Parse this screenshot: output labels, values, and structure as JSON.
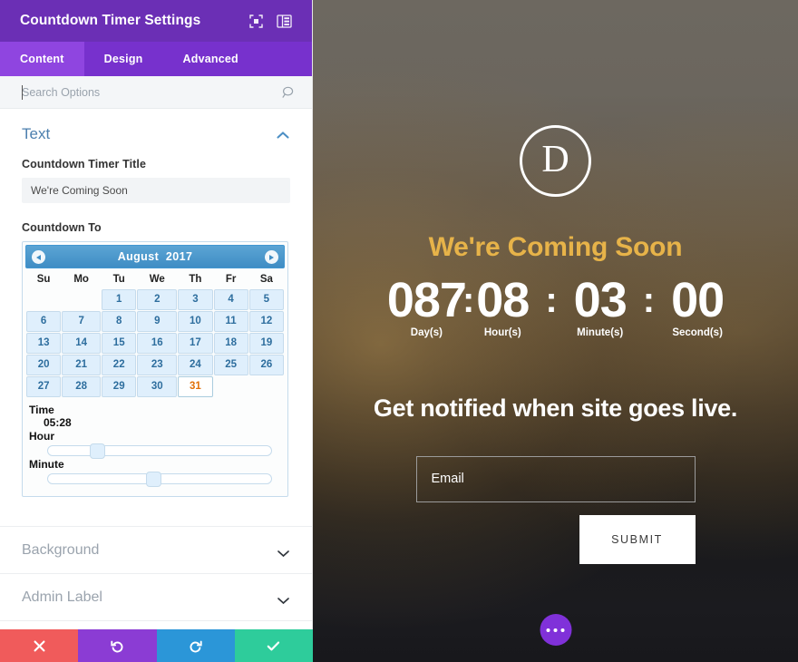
{
  "panel": {
    "title": "Countdown Timer Settings",
    "header_icons": [
      {
        "name": "fullscreen-icon",
        "glyph": "fullscreen"
      },
      {
        "name": "layout-columns-icon",
        "glyph": "layout"
      }
    ],
    "tabs": [
      {
        "label": "Content",
        "active": true
      },
      {
        "label": "Design",
        "active": false
      },
      {
        "label": "Advanced",
        "active": false
      }
    ],
    "search": {
      "placeholder": "Search Options",
      "value": "",
      "icon": "search-icon"
    },
    "section": {
      "title": "Text",
      "toggle_icon": "chevron-up-icon",
      "title_field": {
        "label": "Countdown Timer Title",
        "value": "We're Coming Soon"
      },
      "date_field": {
        "label": "Countdown To"
      }
    },
    "datepicker": {
      "prev_icon": "chevron-left-icon",
      "next_icon": "chevron-right-icon",
      "month": "August",
      "year": "2017",
      "weekdays": [
        "Su",
        "Mo",
        "Tu",
        "We",
        "Th",
        "Fr",
        "Sa"
      ],
      "leading_blanks": 2,
      "days": [
        1,
        2,
        3,
        4,
        5,
        6,
        7,
        8,
        9,
        10,
        11,
        12,
        13,
        14,
        15,
        16,
        17,
        18,
        19,
        20,
        21,
        22,
        23,
        24,
        25,
        26,
        27,
        28,
        29,
        30,
        31
      ],
      "selected_day": 31,
      "time_label": "Time",
      "time_value": "05:28",
      "hour_label": "Hour",
      "hour_percent": 22,
      "minute_label": "Minute",
      "minute_percent": 47
    },
    "accordions": [
      {
        "label": "Background",
        "icon": "chevron-down-icon"
      },
      {
        "label": "Admin Label",
        "icon": "chevron-down-icon"
      }
    ],
    "actions": [
      {
        "name": "close-button",
        "icon": "close-icon",
        "color": "#f05b5b"
      },
      {
        "name": "undo-button",
        "icon": "undo-icon",
        "color": "#8b3cd4"
      },
      {
        "name": "redo-button",
        "icon": "redo-icon",
        "color": "#2b96d8"
      },
      {
        "name": "save-button",
        "icon": "check-icon",
        "color": "#2ecc9b"
      }
    ]
  },
  "preview": {
    "logo_letter": "D",
    "headline": "We're Coming Soon",
    "headline_color": "#e7b349",
    "countdown": {
      "days": {
        "value": "087",
        "label": "Day(s)"
      },
      "hours": {
        "value": "08",
        "label": "Hour(s)"
      },
      "minutes": {
        "value": "03",
        "label": "Minute(s)"
      },
      "seconds": {
        "value": "00",
        "label": "Second(s)"
      },
      "separator": ":"
    },
    "subheadline": "Get notified when site goes live.",
    "email_placeholder": "Email",
    "email_value": "",
    "submit_label": "SUBMIT",
    "fab": {
      "name": "more-options-fab",
      "icon": "ellipsis-icon"
    }
  }
}
